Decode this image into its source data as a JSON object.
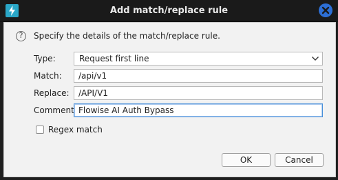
{
  "window": {
    "title": "Add match/replace rule",
    "app_icon": "lightning-icon",
    "close_icon": "close-icon",
    "accent_color": "#2d6fd6"
  },
  "dialog": {
    "help_icon": "help-circle-icon",
    "help_glyph": "?",
    "intro": "Specify the details of the match/replace rule.",
    "type": {
      "label": "Type:",
      "value": "Request first line"
    },
    "match": {
      "label": "Match:",
      "value": "/api/v1"
    },
    "replace": {
      "label": "Replace:",
      "value": "/API/V1"
    },
    "comment": {
      "label": "Comment:",
      "value": "Flowise AI Auth Bypass"
    },
    "regex": {
      "label": "Regex match",
      "checked": false
    },
    "buttons": {
      "ok": "OK",
      "cancel": "Cancel"
    }
  }
}
